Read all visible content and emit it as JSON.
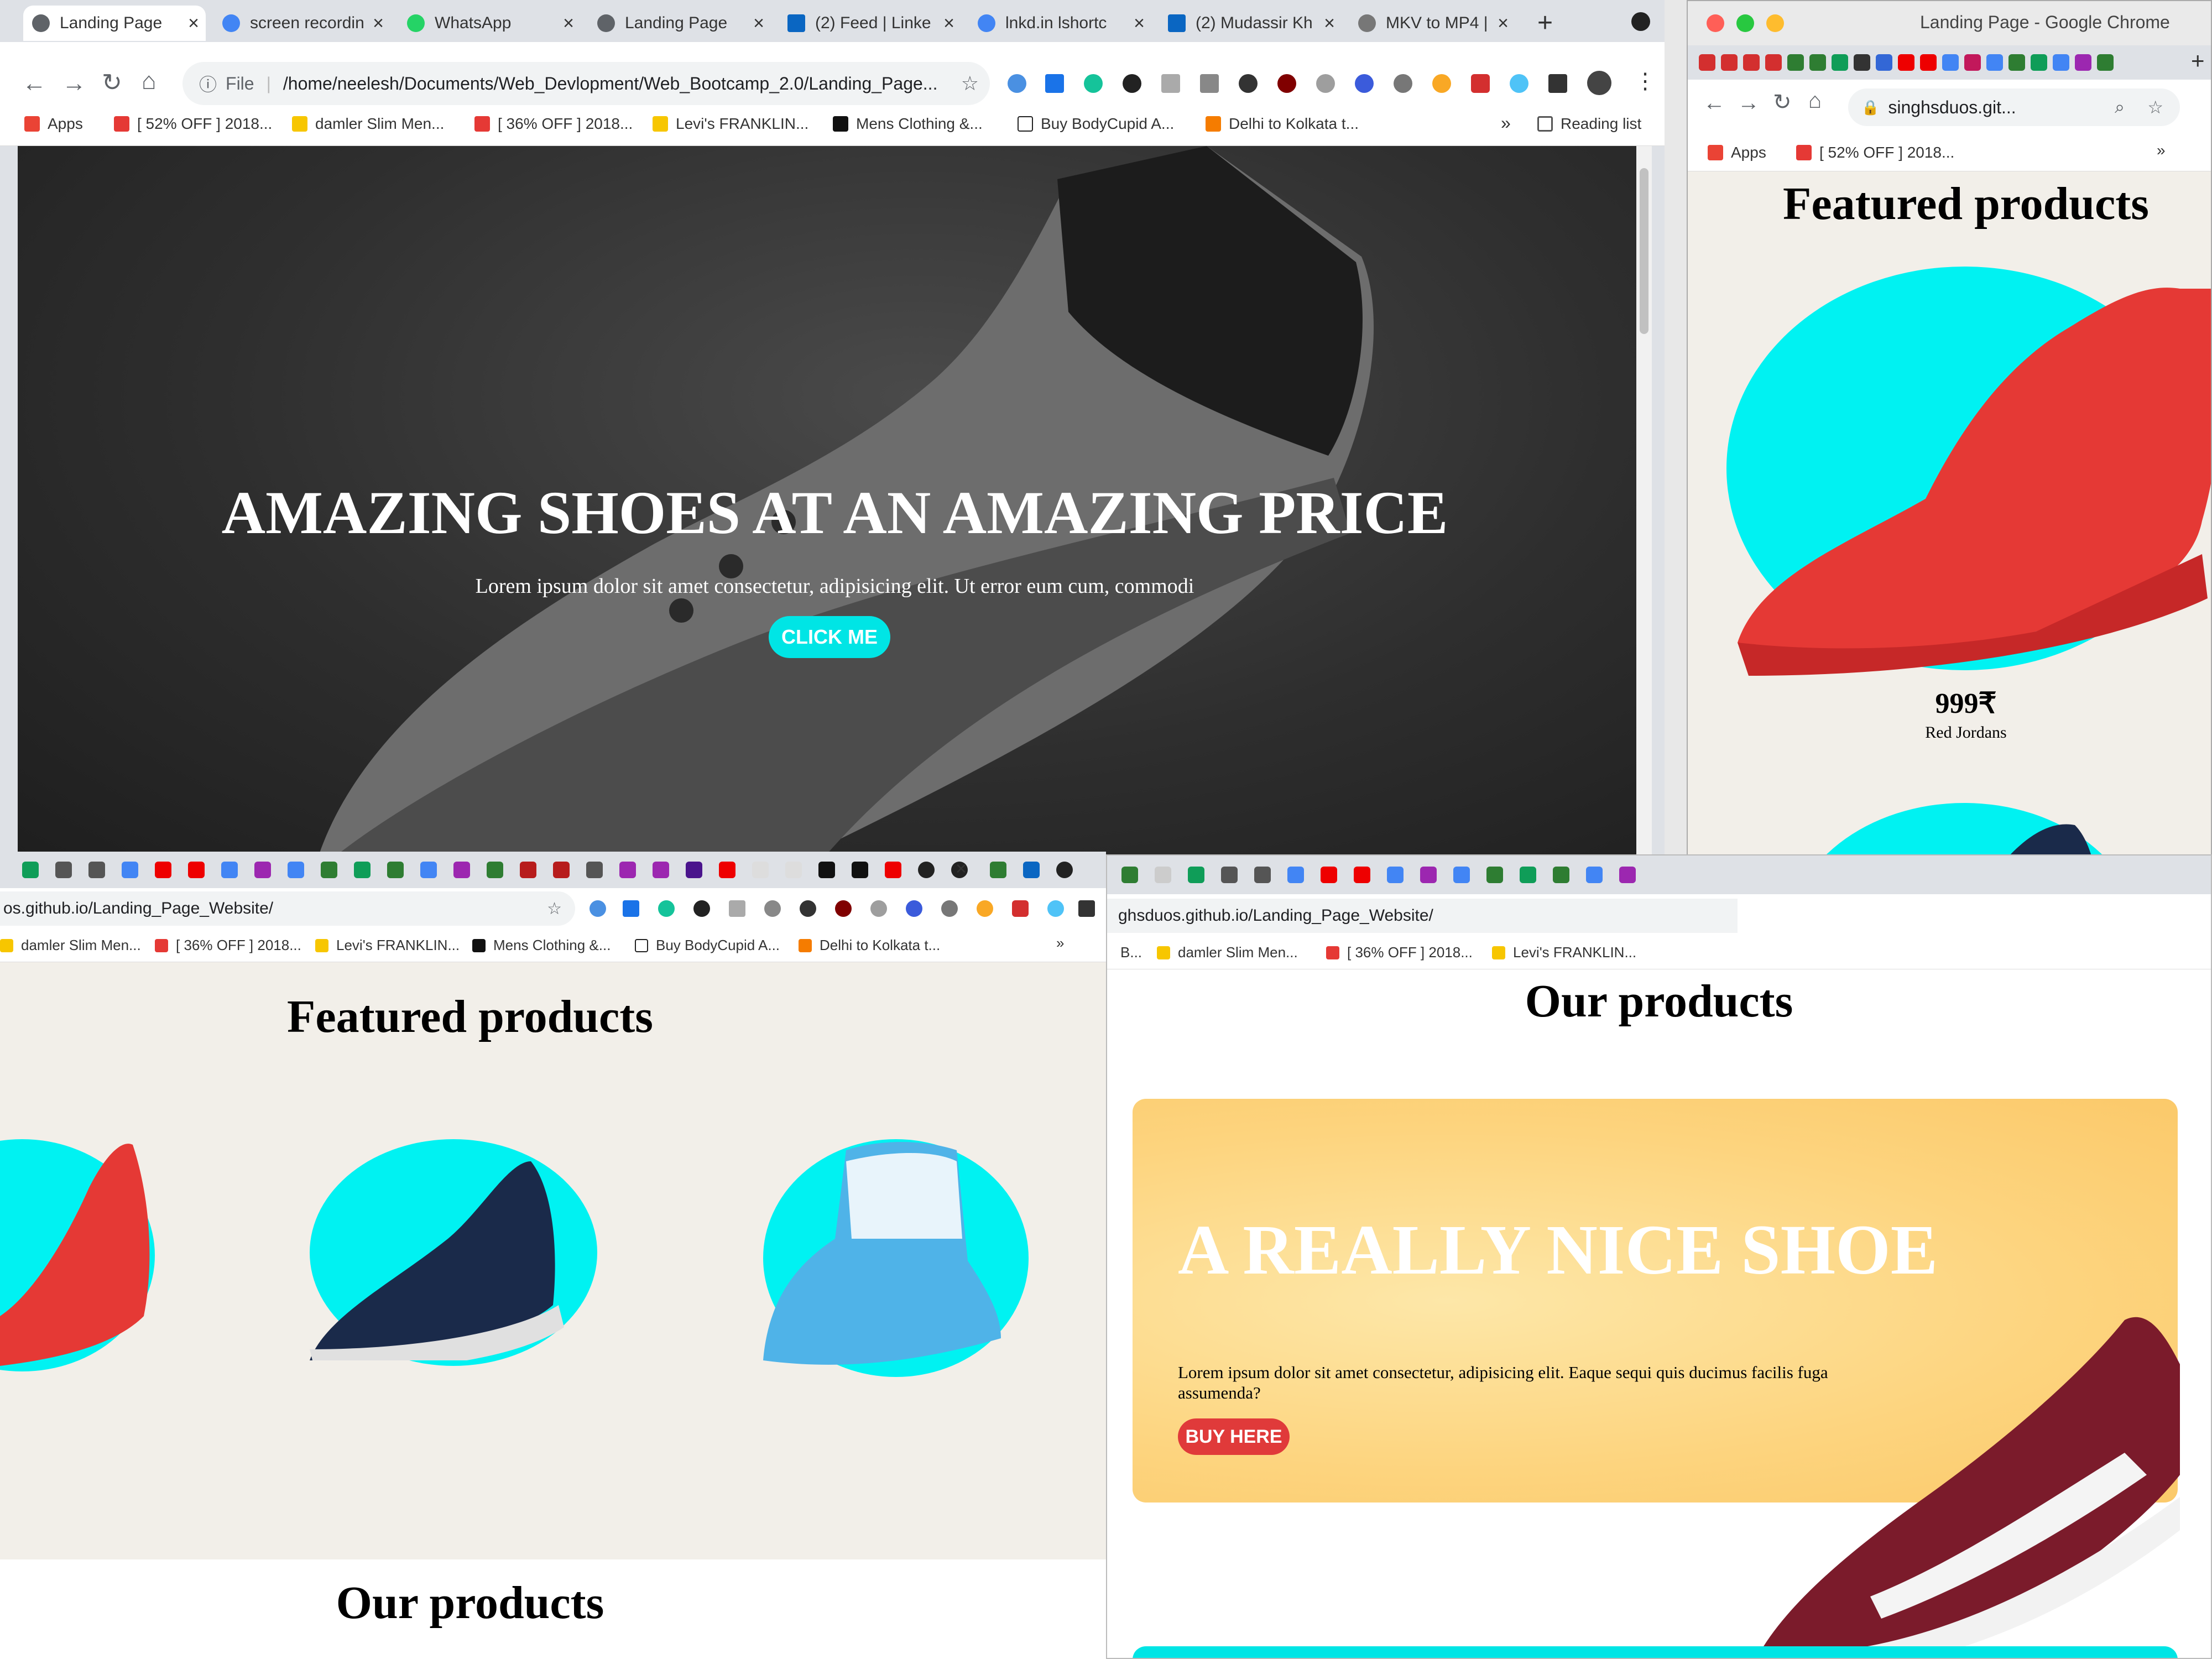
{
  "main_window": {
    "tabs": [
      {
        "label": "Landing Page"
      },
      {
        "label": "screen recordin"
      },
      {
        "label": "WhatsApp"
      },
      {
        "label": "Landing Page"
      },
      {
        "label": "(2) Feed | Linke"
      },
      {
        "label": "lnkd.in lshortc"
      },
      {
        "label": "(2) Mudassir Kh"
      },
      {
        "label": "MKV to MP4 |"
      }
    ],
    "url_prefix": "File",
    "url": "/home/neelesh/Documents/Web_Devlopment/Web_Bootcamp_2.0/Landing_Page...",
    "bookmarks": [
      {
        "label": "Apps"
      },
      {
        "label": "[ 52% OFF ] 2018..."
      },
      {
        "label": "damler Slim Men..."
      },
      {
        "label": "[ 36% OFF ] 2018..."
      },
      {
        "label": "Levi's FRANKLIN..."
      },
      {
        "label": "Mens Clothing &..."
      },
      {
        "label": "Buy BodyCupid A..."
      },
      {
        "label": "Delhi to Kolkata t..."
      }
    ],
    "reading_list": "Reading list",
    "hero": {
      "title": "AMAZING SHOES AT AN AMAZING PRICE",
      "text": "Lorem ipsum dolor sit amet consectetur, adipisicing elit. Ut error eum cum, commodi",
      "button": "CLICK ME"
    }
  },
  "mobile_window": {
    "title": "Landing Page - Google Chrome",
    "url": "singhsduos.git...",
    "bookmark": "[ 52% OFF ] 2018...",
    "apps": "Apps",
    "heading": "Featured products",
    "price": "999₹",
    "product_name": "Red Jordans"
  },
  "left_window": {
    "url": "os.github.io/Landing_Page_Website/",
    "bookmarks": [
      {
        "label": "damler Slim Men..."
      },
      {
        "label": "[ 36% OFF ] 2018..."
      },
      {
        "label": "Levi's FRANKLIN..."
      },
      {
        "label": "Mens Clothing &..."
      },
      {
        "label": "Buy BodyCupid A..."
      },
      {
        "label": "Delhi to Kolkata t..."
      }
    ],
    "heading": "Featured products",
    "footer_heading": "Our products"
  },
  "right_window": {
    "url": "ghsduos.github.io/Landing_Page_Website/",
    "bookmarks": [
      {
        "label": "B..."
      },
      {
        "label": "damler Slim Men..."
      },
      {
        "label": "[ 36% OFF ] 2018..."
      },
      {
        "label": "Levi's FRANKLIN..."
      }
    ],
    "heading": "Our products",
    "card": {
      "title": "A REALLY NICE SHOE",
      "text": "Lorem ipsum dolor sit amet consectetur, adipisicing elit. Eaque sequi quis ducimus facilis fuga assumenda?",
      "button": "BUY HERE"
    }
  },
  "colors": {
    "cyan": "#00f2f2",
    "card_yellow": "#fdd47e",
    "buy_red": "#e03a3a",
    "page_beige": "#f2efe9",
    "hero_dark": "#2b2b2b"
  }
}
